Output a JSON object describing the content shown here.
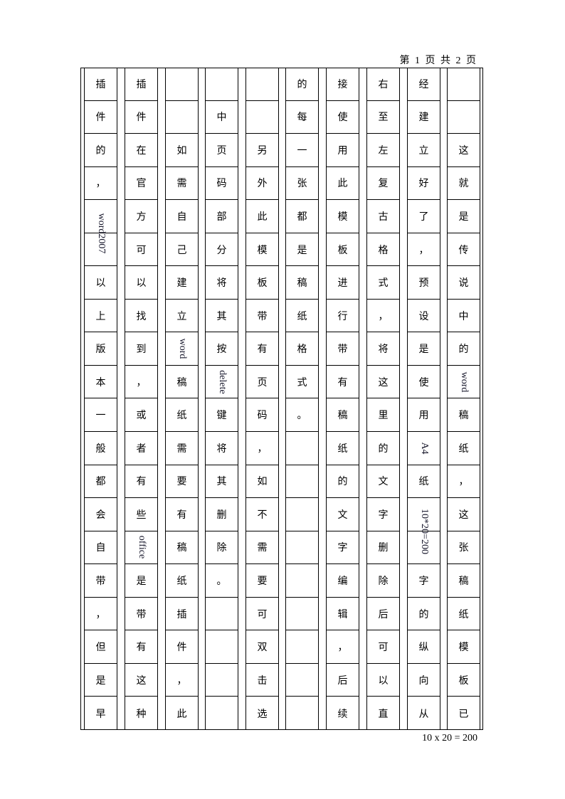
{
  "header": {
    "page_indicator": "第 1 页 共 2 页"
  },
  "footer": {
    "grid_size": "10 x 20 = 200"
  },
  "columns": [
    [
      "插",
      "件",
      "的",
      "，",
      "",
      "",
      "以",
      "上",
      "版",
      "本",
      "一",
      "般",
      "都",
      "会",
      "自",
      "带",
      "，",
      "但",
      "是",
      "早"
    ],
    [
      "插",
      "件",
      "在",
      "官",
      "方",
      "可",
      "以",
      "找",
      "到",
      "，",
      "或",
      "者",
      "有",
      "些",
      "office",
      "是",
      "带",
      "有",
      "这",
      "种"
    ],
    [
      "",
      "",
      "如",
      "需",
      "自",
      "己",
      "建",
      "立",
      "word",
      "稿",
      "纸",
      "需",
      "要",
      "有",
      "稿",
      "纸",
      "插",
      "件",
      "，",
      "此"
    ],
    [
      "",
      "中",
      "页",
      "码",
      "部",
      "分",
      "将",
      "其",
      "按",
      "delete",
      "键",
      "将",
      "其",
      "删",
      "除",
      "。",
      "",
      "",
      "",
      ""
    ],
    [
      "",
      "",
      "另",
      "外",
      "此",
      "模",
      "板",
      "带",
      "有",
      "页",
      "码",
      "，",
      "如",
      "不",
      "需",
      "要",
      "可",
      "双",
      "击",
      "选"
    ],
    [
      "的",
      "每",
      "一",
      "张",
      "都",
      "是",
      "稿",
      "纸",
      "格",
      "式",
      "。",
      "",
      "",
      "",
      "",
      "",
      "",
      "",
      "",
      ""
    ],
    [
      "接",
      "使",
      "用",
      "此",
      "模",
      "板",
      "进",
      "行",
      "带",
      "有",
      "稿",
      "纸",
      "的",
      "文",
      "字",
      "编",
      "辑",
      "，",
      "后",
      "续"
    ],
    [
      "右",
      "至",
      "左",
      "复",
      "古",
      "格",
      "式",
      "，",
      "将",
      "这",
      "里",
      "的",
      "文",
      "字",
      "删",
      "除",
      "后",
      "可",
      "以",
      "直"
    ],
    [
      "经",
      "建",
      "立",
      "好",
      "了",
      "，",
      "预",
      "设",
      "是",
      "使",
      "用",
      "A4",
      "纸",
      "",
      "",
      "字",
      "的",
      "纵",
      "向",
      "从"
    ],
    [
      "",
      "",
      "这",
      "就",
      "是",
      "传",
      "说",
      "中",
      "的",
      "word",
      "稿",
      "纸",
      "，",
      "这",
      "张",
      "稿",
      "纸",
      "模",
      "板",
      "已"
    ]
  ],
  "rotated_cells": [
    {
      "col": 0,
      "row": 4,
      "span": 2,
      "text": "word2007"
    },
    {
      "col": 8,
      "row": 13,
      "span": 2,
      "text": "10*20=200"
    }
  ],
  "rotated_single": [
    "office",
    "word",
    "delete",
    "A4"
  ]
}
